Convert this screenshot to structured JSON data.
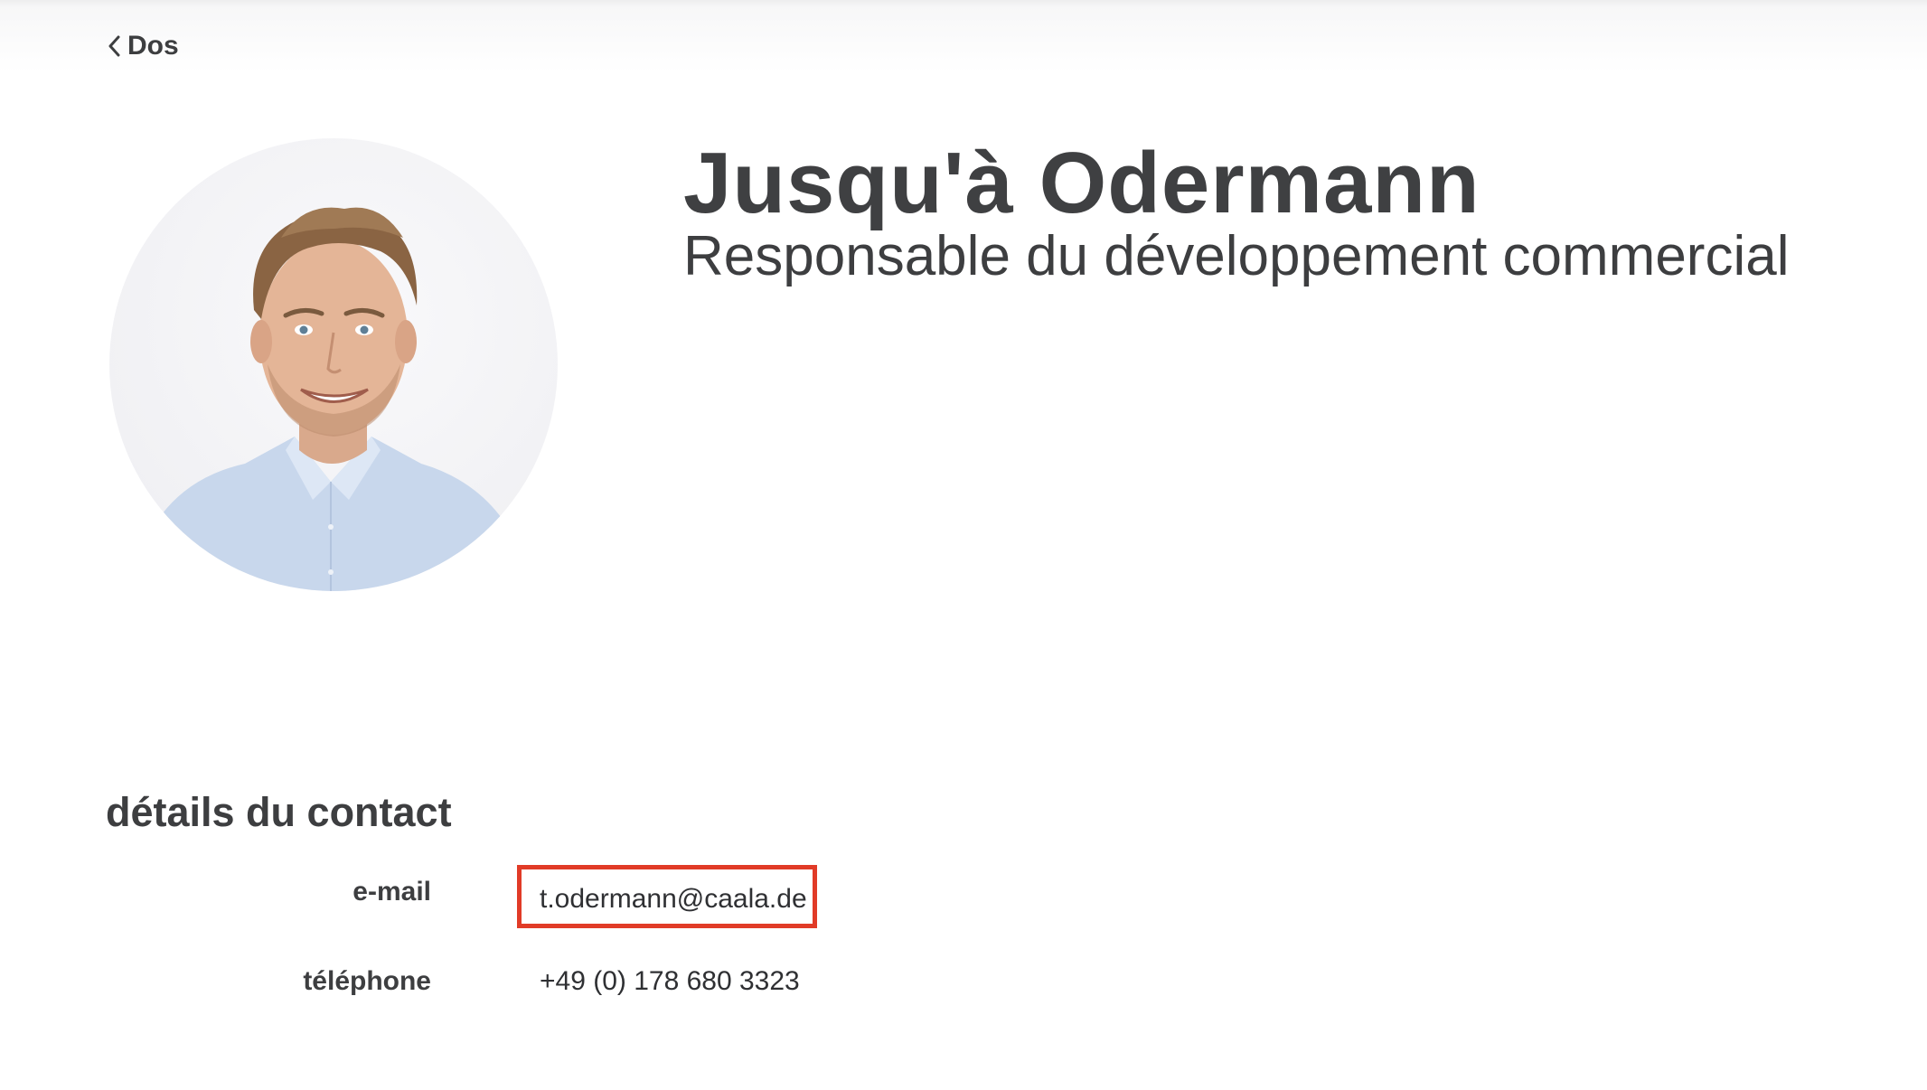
{
  "nav": {
    "back_label": "Dos"
  },
  "profile": {
    "name": "Jusqu'à Odermann",
    "role": "Responsable du développement commercial"
  },
  "contact": {
    "section_title": "détails du contact",
    "email_label": "e-mail",
    "email_value": "t.odermann@caala.de",
    "phone_label": "téléphone",
    "phone_value": "+49 (0) 178 680 3323"
  },
  "colors": {
    "text": "#3d3e40",
    "highlight_border": "#e13b27",
    "shirt": "#c9d8ee"
  },
  "icons": {
    "back": "chevron-left-icon"
  }
}
